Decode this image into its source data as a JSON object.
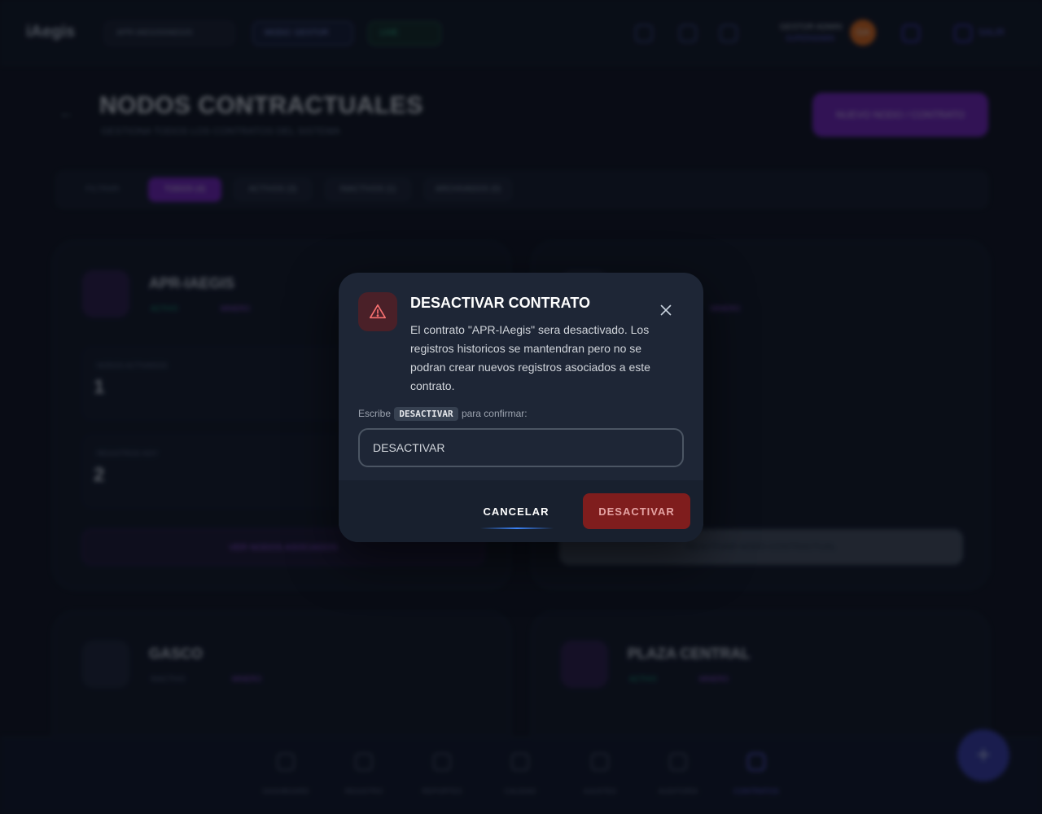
{
  "app": {
    "logo": "iAegis",
    "header": {
      "contract_selector": "APR-IAEGIS/IAEGIS",
      "mode_label": "MODO: GESTOR",
      "status_label": "LIVE",
      "user_name": "GESTOR ADMIN",
      "user_role": "SUPERADMIN",
      "avatar_initials": "GA",
      "logout_label": "SALIR"
    },
    "page": {
      "title": "NODOS CONTRACTUALES",
      "subtitle": "GESTIONA TODOS LOS CONTRATOS DEL SISTEMA",
      "new_button": "NUEVO NODO / CONTRATO",
      "filters": {
        "label": "FILTRAR:",
        "chips": [
          "TODOS (4)",
          "ACTIVOS (3)",
          "INACTIVOS (1)",
          "ARCHIVADOS (0)"
        ]
      }
    },
    "cards": [
      {
        "title": "APR-IAEGIS",
        "status": "ACTIVO",
        "type": "MINERO",
        "stat1_label": "NODOS ACTIVADOS",
        "stat1_value": "1",
        "stat2_label": "REGISTROS HOY",
        "stat2_value": "2",
        "link": "VER NODOS ASOCIADOS"
      },
      {
        "title": "",
        "type": "MINERO",
        "link": "REACTIVAR NODO CONTRACTUAL"
      },
      {
        "title": "GASCO",
        "status": "INACTIVO",
        "type": "MINERO"
      },
      {
        "title": "PLAZA CENTRAL",
        "status": "ACTIVO",
        "type": "MINERO"
      }
    ],
    "bottom_nav": [
      "DASHBOARD",
      "REGISTRO",
      "REPORTES",
      "CALIDAD",
      "AJUSTES",
      "AUDITORÍA",
      "CONTRATOS"
    ],
    "fab_symbol": "+"
  },
  "modal": {
    "title": "DESACTIVAR CONTRATO",
    "description": "El contrato \"APR-IAegis\" sera desactivado. Los registros historicos se mantendran pero no se podran crear nuevos registros asociados a este contrato.",
    "confirm_prefix": "Escribe",
    "confirm_keyword": "DESACTIVAR",
    "confirm_suffix": "para confirmar:",
    "input_value": "DESACTIVAR",
    "cancel_label": "CANCELAR",
    "deactivate_label": "DESACTIVAR",
    "colors": {
      "danger": "#7f1d1d",
      "warning_icon": "#f87171",
      "surface": "#1e2636"
    }
  }
}
